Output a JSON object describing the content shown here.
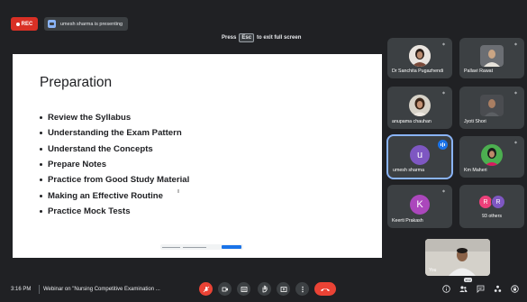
{
  "top_bar": {
    "rec_label": "REC",
    "presenter_text": "umesh sharma is presenting"
  },
  "fullscreen_hint": {
    "press": "Press",
    "key": "Esc",
    "rest": "to exit full screen"
  },
  "slide": {
    "title": "Preparation",
    "bullets": [
      "Review the Syllabus",
      "Understanding the Exam Pattern",
      "Understand the Concepts",
      "Prepare Notes",
      "Practice from Good Study Material",
      "Making an Effective Routine",
      "Practice Mock Tests"
    ]
  },
  "participants": [
    {
      "name": "Dr Sanchita Pugazhendi",
      "avatar": "photo"
    },
    {
      "name": "Pallavi Rawat",
      "avatar": "photo"
    },
    {
      "name": "anupama chauhan",
      "avatar": "photo"
    },
    {
      "name": "Jyoti Shori",
      "avatar": "photo"
    },
    {
      "name": "umesh sharma",
      "avatar": "letter",
      "letter": "u",
      "color": "#7e57c2",
      "speaking": true
    },
    {
      "name": "Km Maheri",
      "avatar": "photo"
    },
    {
      "name": "Keerti Prakash",
      "avatar": "letter",
      "letter": "K",
      "color": "#ab47bc"
    },
    {
      "name": "93 others",
      "avatar": "group",
      "letters": [
        "R",
        "R"
      ],
      "colors": [
        "#ec407a",
        "#7e57c2"
      ]
    }
  ],
  "self_view": {
    "label": "You"
  },
  "bottom_bar": {
    "time": "3:16 PM",
    "meeting_title": "Webinar on \"Nursing Competitive Examination ...",
    "chat_count": "102"
  },
  "colors": {
    "background": "#202124",
    "tile": "#3c4043",
    "accent_red": "#ea4335",
    "accent_blue": "#8ab4f8"
  },
  "icons": [
    "mic-off-icon",
    "present-icon",
    "captions-icon",
    "raise-hand-icon",
    "present-now-icon",
    "more-icon",
    "end-call-icon",
    "info-icon",
    "people-icon",
    "chat-icon",
    "activities-icon",
    "lock-icon",
    "pin-icon"
  ]
}
